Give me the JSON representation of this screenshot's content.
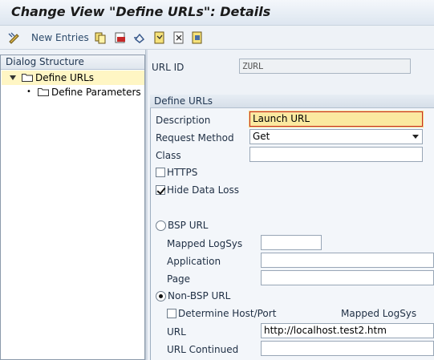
{
  "window": {
    "title": "Change View \"Define URLs\": Details"
  },
  "toolbar": {
    "new_entries_label": "New Entries"
  },
  "tree": {
    "header": "Dialog Structure",
    "items": [
      {
        "label": "Define URLs",
        "selected": true
      },
      {
        "label": "Define Parameters",
        "selected": false
      }
    ]
  },
  "header_fields": {
    "url_id_label": "URL ID",
    "url_id_value": "ZURL"
  },
  "group": {
    "title": "Define URLs",
    "description_label": "Description",
    "description_value": "Launch URL",
    "request_method_label": "Request Method",
    "request_method_value": "Get",
    "class_label": "Class",
    "class_value": "",
    "https_label": "HTTPS",
    "https_checked": false,
    "hide_data_loss_label": "Hide Data Loss",
    "hide_data_loss_checked": true
  },
  "bsp": {
    "radio_label": "BSP URL",
    "selected": false,
    "mapped_logsys_label": "Mapped LogSys",
    "application_label": "Application",
    "page_label": "Page"
  },
  "non_bsp": {
    "radio_label": "Non-BSP  URL",
    "selected": true,
    "determine_host_label": "Determine Host/Port",
    "determine_host_checked": false,
    "mapped_logsys_label": "Mapped LogSys",
    "url_label": "URL",
    "url_value": "http://localhost.test2.htm",
    "url_continued_label": "URL Continued",
    "url_continued_value": ""
  },
  "colors": {
    "focus_bg": "#fbe9a0",
    "tree_selected": "#fff6c4",
    "accent_title": "#1a1a1a"
  }
}
